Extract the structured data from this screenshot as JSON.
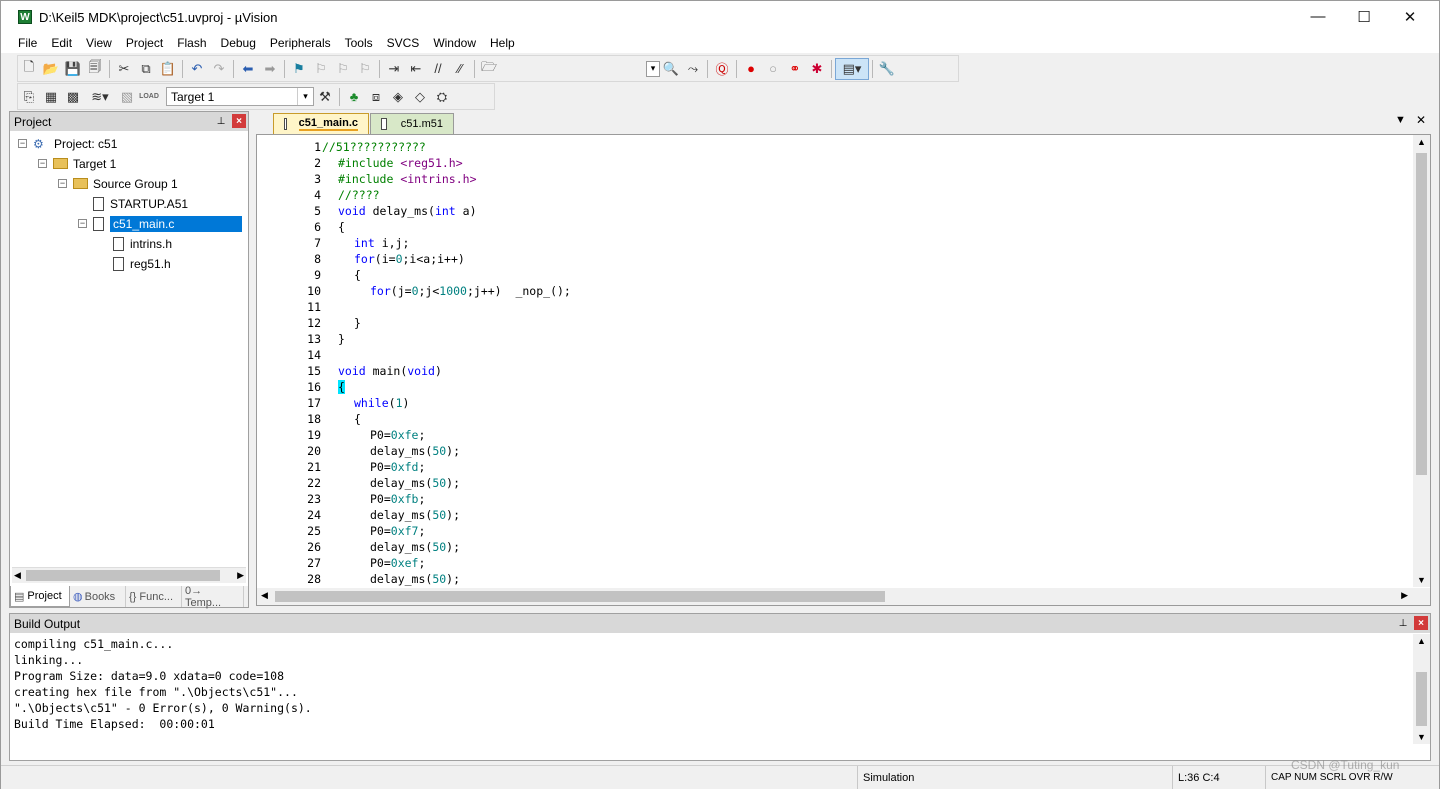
{
  "window": {
    "title": "D:\\Keil5 MDK\\project\\c51.uvproj - µVision",
    "minimize": "—",
    "maximize": "☐",
    "close": "✕"
  },
  "menu": [
    "File",
    "Edit",
    "View",
    "Project",
    "Flash",
    "Debug",
    "Peripherals",
    "Tools",
    "SVCS",
    "Window",
    "Help"
  ],
  "toolbar2": {
    "target_label": "Target 1"
  },
  "project_panel": {
    "title": "Project",
    "tree": [
      {
        "label": "Project: c51"
      },
      {
        "label": "Target 1"
      },
      {
        "label": "Source Group 1"
      },
      {
        "label": "STARTUP.A51"
      },
      {
        "label": "c51_main.c"
      },
      {
        "label": "intrins.h"
      },
      {
        "label": "reg51.h"
      }
    ],
    "tabs": [
      "Project",
      "Books",
      "{} Func...",
      "0→ Temp..."
    ]
  },
  "editor": {
    "tabs": [
      "c51_main.c",
      "c51.m51"
    ],
    "active_tab": "c51_main.c",
    "lines": [
      "1",
      "2",
      "3",
      "4",
      "5",
      "6",
      "7",
      "8",
      "9",
      "10",
      "11",
      "12",
      "13",
      "14",
      "15",
      "16",
      "17",
      "18",
      "19",
      "20",
      "21",
      "22",
      "23",
      "24",
      "25",
      "26",
      "27",
      "28"
    ]
  },
  "build_output": {
    "title": "Build Output",
    "lines": [
      "compiling c51_main.c...",
      "linking...",
      "Program Size: data=9.0 xdata=0 code=108",
      "creating hex file from \".\\Objects\\c51\"...",
      "\".\\Objects\\c51\" - 0 Error(s), 0 Warning(s).",
      "Build Time Elapsed:  00:00:01"
    ]
  },
  "statusbar": {
    "mode": "Simulation",
    "position": "L:36 C:4",
    "flags": "CAP  NUM  SCRL  OVR  R/W",
    "watermark": "CSDN @Tuting_kun"
  }
}
